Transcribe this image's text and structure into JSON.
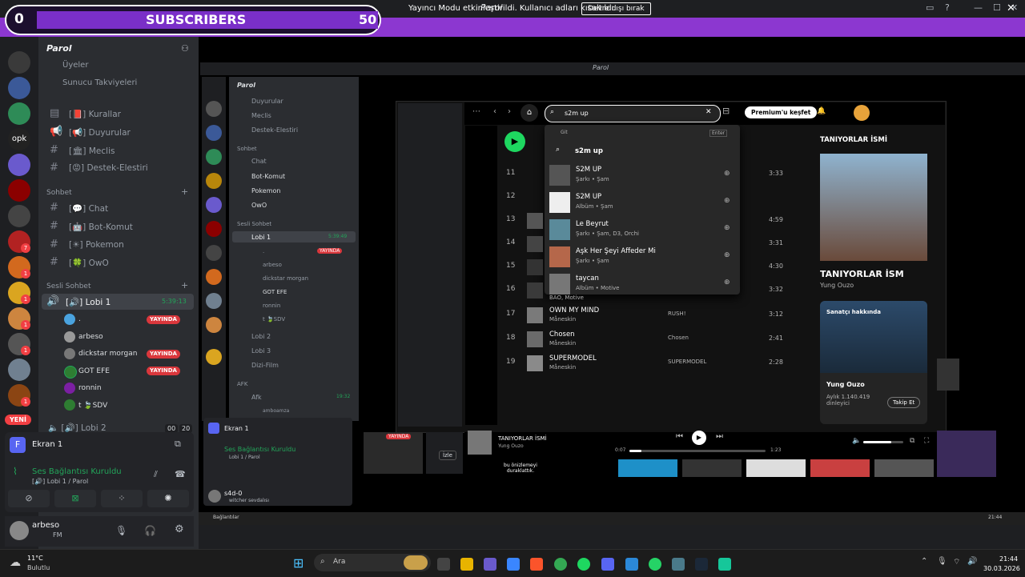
{
  "window": {
    "title": "Parol"
  },
  "banner": {
    "text": "Yayıncı Modu etkinleştirildi. Kullanıcı adları kısaltıldı.",
    "button": "Devre dışı bırak"
  },
  "overlay": {
    "left_count": "0",
    "label": "SUBSCRIBERS",
    "goal": "50"
  },
  "rail": {
    "opk_label": "opk",
    "new_label": "YENİ",
    "badges": [
      "7",
      "1",
      "1",
      "1",
      "1",
      "1"
    ]
  },
  "server": {
    "name": "Parol",
    "members": "Üyeler",
    "boosts": "Sunucu Takviyeleri"
  },
  "text_channels": [
    {
      "name": "[📕] Kurallar"
    },
    {
      "name": "[📢] Duyurular"
    },
    {
      "name": "[🏛] Meclis"
    },
    {
      "name": "[😡] Destek-Elestiri"
    }
  ],
  "category_chat": "Sohbet",
  "chat_channels": [
    {
      "name": "[💬] Chat"
    },
    {
      "name": "[🤖] Bot-Komut"
    },
    {
      "name": "[☀] Pokemon"
    },
    {
      "name": "[🍀] OwO"
    }
  ],
  "category_voice": "Sesli Sohbet",
  "voice_channel": {
    "name": "[🔊] Lobi 1",
    "time": "5:39:13"
  },
  "voice_users": [
    {
      "name": "."
    },
    {
      "name": "arbeso",
      "badge": "YAYINDA"
    },
    {
      "name": "dickstar morgan",
      "badge": "YAYINDA"
    },
    {
      "name": "GOT EFE",
      "badge": "YAYINDA"
    },
    {
      "name": "ronnin"
    },
    {
      "name": "t 🍃SDV"
    }
  ],
  "voice_channel2": {
    "name": "[🔊] Lobi 2",
    "c1": "00",
    "c2": "20"
  },
  "stream_tile": {
    "title": "Ekran 1"
  },
  "voice_status": {
    "title": "Ses Bağlantısı Kuruldu",
    "sub": "[🔊] Lobi 1 / Parol"
  },
  "user": {
    "name": "arbeso",
    "status": "FM"
  },
  "inner": {
    "title": "Parol",
    "server": "Parol",
    "channels": [
      "Duyurular",
      "Meclis",
      "Destek-Elestiri"
    ],
    "cat_chat": "Sohbet",
    "chat": [
      "Chat",
      "Bot-Komut",
      "Pokemon",
      "OwO"
    ],
    "cat_voice": "Sesli Sohbet",
    "lobi1": "Lobi 1",
    "lobi1_time": "5:39:49",
    "users": [
      ".",
      "arbeso",
      "dickstar morgan",
      "GOT EFE",
      "ronnin",
      "t 🍃SDV"
    ],
    "lobi2": "Lobi 2",
    "lobi3": "Lobi 3",
    "dizi": "Dizi-Film",
    "cat_afk": "AFK",
    "afk": "Afk",
    "afk_time": "19:32",
    "afk_user": "amboamza",
    "live": "YAYINDA",
    "ekran": "Ekran 1",
    "voice_title": "Ses Bağlantısı Kuruldu",
    "voice_sub": "Lobi 1 / Parol",
    "user": "s4d-0",
    "user_sub": "witcher sevdalısı",
    "taskbar_label": "Bağlantılar",
    "taskbar_time": "21:44"
  },
  "spotify": {
    "search_query": "s2m up",
    "premium": "Premium'u keşfet",
    "dd_header_left": "Git",
    "dd_header_right": "Enter",
    "dd_query": "s2m up",
    "results": [
      {
        "title": "S2M UP",
        "sub": "Şarkı • Şam"
      },
      {
        "title": "S2M UP",
        "sub": "Albüm • Şam"
      },
      {
        "title": "Le Beyrut",
        "sub": "Şarkı • Şam, D3, Orchi"
      },
      {
        "title": "Aşk Her Şeyi Affeder Mi",
        "sub": "Şarkı • Şam"
      },
      {
        "title": "taycan",
        "sub": "Albüm • Motive"
      }
    ],
    "tracks": [
      {
        "n": "11",
        "title": "",
        "artist": "",
        "album": "",
        "dur": "3:33"
      },
      {
        "n": "12",
        "title": "",
        "artist": "",
        "album": "",
        "dur": ""
      },
      {
        "n": "13",
        "title": "",
        "artist": "",
        "album": "",
        "dur": "4:59"
      },
      {
        "n": "14",
        "title": "",
        "artist": "",
        "album": "",
        "dur": "3:31"
      },
      {
        "n": "15",
        "title": "",
        "artist": "",
        "album": "",
        "dur": "4:30"
      },
      {
        "n": "16",
        "title": "",
        "artist": "BAO, Motive",
        "album": "",
        "dur": "3:32"
      },
      {
        "n": "17",
        "title": "OWN MY MIND",
        "artist": "Måneskin",
        "album": "RUSH!",
        "dur": "3:12"
      },
      {
        "n": "18",
        "title": "Chosen",
        "artist": "Måneskin",
        "album": "Chosen",
        "dur": "2:41"
      },
      {
        "n": "19",
        "title": "SUPERMODEL",
        "artist": "Måneskin",
        "album": "SUPERMODEL",
        "dur": "2:28"
      }
    ],
    "right_title": "TANIYORLAR İSMİ",
    "right_song": "TANIYORLAR İSM",
    "right_artist": "Yung Ouzo",
    "about_label": "Sanatçı hakkında",
    "about_artist": "Yung Ouzo",
    "listeners": "Aylık 1.140.419 dinleyici",
    "follow": "Takip Et",
    "now_title": "TANIYORLAR İSMİ",
    "now_artist": "Yung Ouzo",
    "elapsed": "0:07",
    "total": "1:23",
    "progress": 0.09,
    "volume": 0.7,
    "thumb_live": "YAYINDA",
    "thumb_watch": "İzle",
    "preview_text": "bu önizlemeyi duraklattık."
  },
  "taskbar": {
    "weather_temp": "11°C",
    "weather_desc": "Bulutlu",
    "search": "Ara",
    "time": "21:44",
    "date": "30.03.2026"
  }
}
